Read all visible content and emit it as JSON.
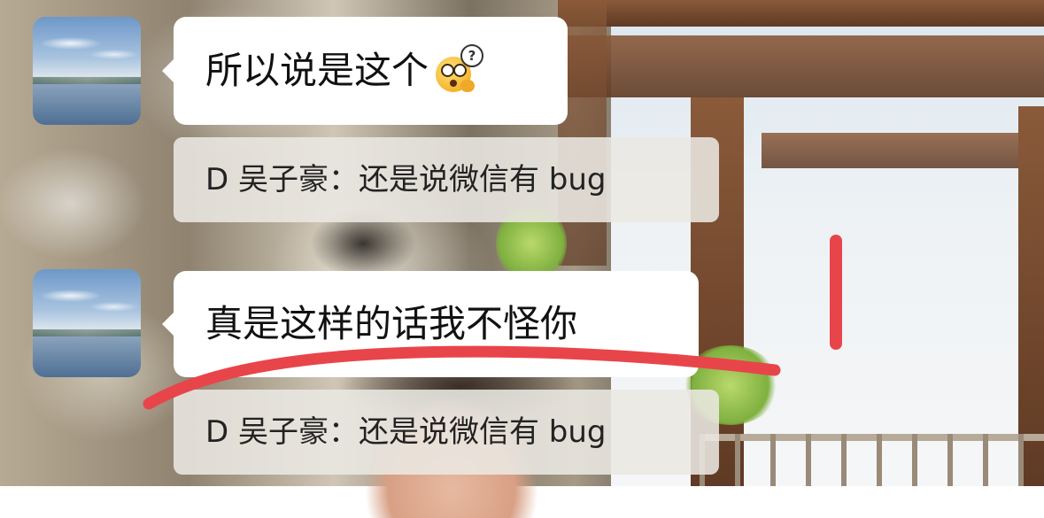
{
  "messages": [
    {
      "type": "text",
      "text": "所以说是这个",
      "emoji": "confused-face-question-emoji"
    },
    {
      "type": "quote",
      "text": "D 吴子豪：还是说微信有 bug"
    },
    {
      "type": "text",
      "text": "真是这样的话我不怪你"
    },
    {
      "type": "quote",
      "text": "D 吴子豪：还是说微信有 bug"
    }
  ],
  "emoji_question_mark": "?",
  "colors": {
    "bubble": "#ffffff",
    "quote_bg": "#ebe8e2",
    "annotation_red": "#e8454a"
  }
}
